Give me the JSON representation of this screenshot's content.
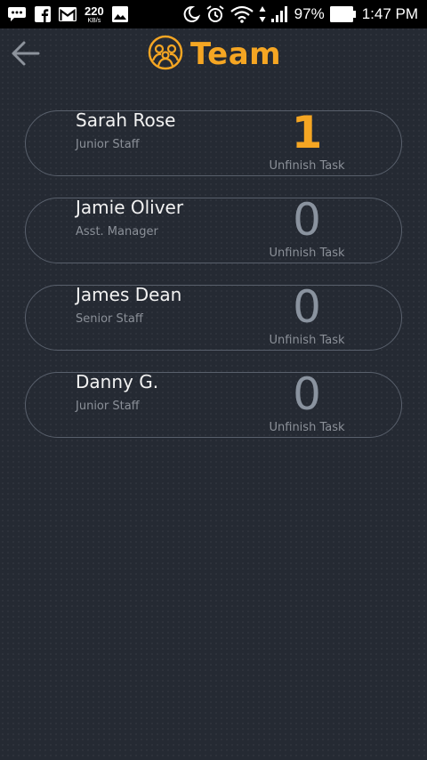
{
  "status_bar": {
    "network_speed": "220",
    "network_speed_unit": "KB/s",
    "battery": "97%",
    "time": "1:47 PM",
    "icons": [
      "chat-icon",
      "facebook-icon",
      "gmail-icon",
      "image-icon",
      "moon-icon",
      "alarm-icon",
      "wifi-icon",
      "signal-icon",
      "battery-icon"
    ]
  },
  "header": {
    "title": "Team",
    "back_icon": "arrow-left-icon",
    "title_icon": "team-icon",
    "accent_color": "#f5a623"
  },
  "team": [
    {
      "name": "Sarah Rose",
      "role": "Junior Staff",
      "count": "1",
      "count_label": "Unfinish Task"
    },
    {
      "name": "Jamie Oliver",
      "role": "Asst. Manager",
      "count": "0",
      "count_label": "Unfinish Task"
    },
    {
      "name": "James Dean",
      "role": "Senior Staff",
      "count": "0",
      "count_label": "Unfinish Task"
    },
    {
      "name": "Danny G.",
      "role": "Junior Staff",
      "count": "0",
      "count_label": "Unfinish Task"
    }
  ]
}
